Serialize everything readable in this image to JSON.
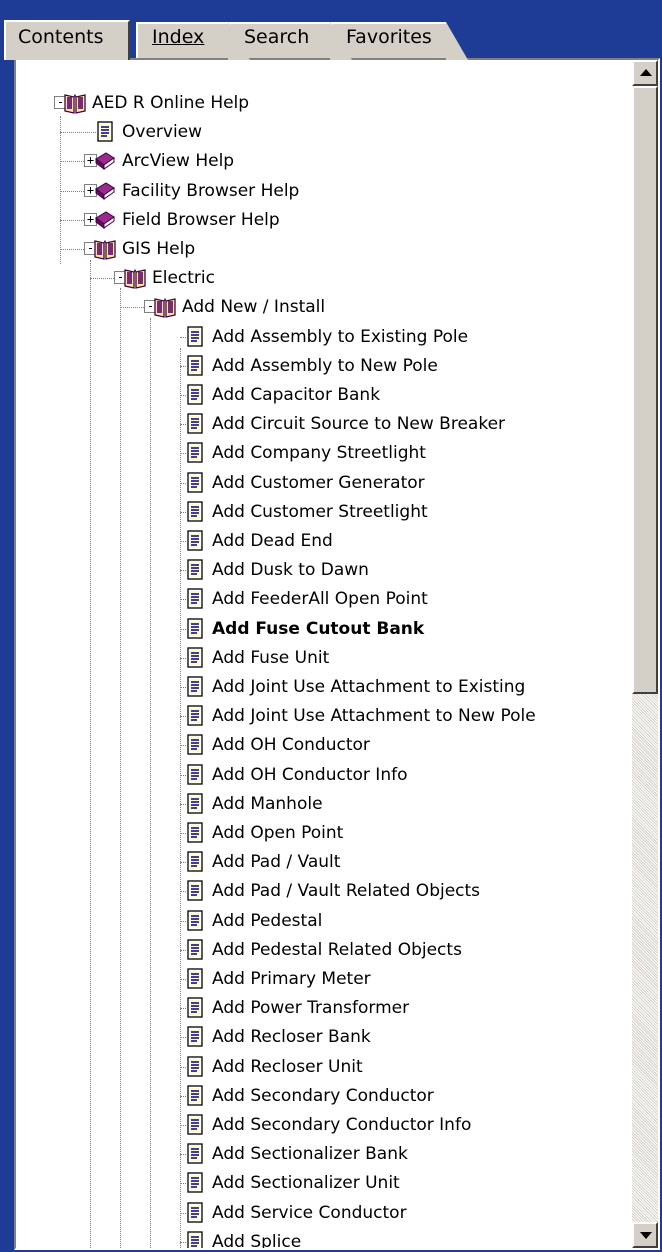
{
  "tabs": [
    {
      "label": "Contents",
      "active": true
    },
    {
      "label": "Index",
      "active": false
    },
    {
      "label": "Search",
      "active": false
    },
    {
      "label": "Favorites",
      "active": false
    }
  ],
  "tree": {
    "root": {
      "label": "AED R Online Help",
      "expanded": true,
      "icon": "open-book-icon"
    },
    "level1": [
      {
        "label": "Overview",
        "icon": "page-icon"
      },
      {
        "label": "ArcView Help",
        "icon": "closed-book-icon",
        "expanded": false
      },
      {
        "label": "Facility Browser Help",
        "icon": "closed-book-icon",
        "expanded": false
      },
      {
        "label": "Field Browser Help",
        "icon": "closed-book-icon",
        "expanded": false
      },
      {
        "label": "GIS Help",
        "icon": "open-book-icon",
        "expanded": true
      }
    ],
    "electric": {
      "label": "Electric",
      "icon": "open-book-icon",
      "expanded": true
    },
    "add_new": {
      "label": "Add New / Install",
      "icon": "open-book-icon",
      "expanded": true
    },
    "pages": [
      "Add Assembly to Existing Pole",
      "Add Assembly to New Pole",
      "Add Capacitor Bank",
      "Add Circuit Source to New Breaker",
      "Add Company Streetlight",
      "Add Customer Generator",
      "Add Customer Streetlight",
      "Add Dead End",
      "Add Dusk to Dawn",
      "Add FeederAll Open Point",
      "Add Fuse Cutout Bank",
      "Add Fuse Unit",
      "Add Joint Use Attachment to Existing",
      "Add Joint Use Attachment to New Pole",
      "Add OH Conductor",
      "Add OH Conductor Info",
      "Add Manhole",
      "Add Open Point",
      "Add Pad / Vault",
      "Add Pad / Vault Related Objects",
      "Add Pedestal",
      "Add Pedestal Related Objects",
      "Add Primary Meter",
      "Add Power Transformer",
      "Add Recloser Bank",
      "Add Recloser Unit",
      "Add Secondary Conductor",
      "Add Secondary Conductor Info",
      "Add Sectionalizer Bank",
      "Add Sectionalizer Unit",
      "Add Service Conductor",
      "Add Splice"
    ],
    "selected_page": "Add Fuse Cutout Bank"
  },
  "scroll": {
    "position": 0.0
  },
  "colors": {
    "frame": "#1e3c96",
    "face": "#d4d0c8"
  }
}
